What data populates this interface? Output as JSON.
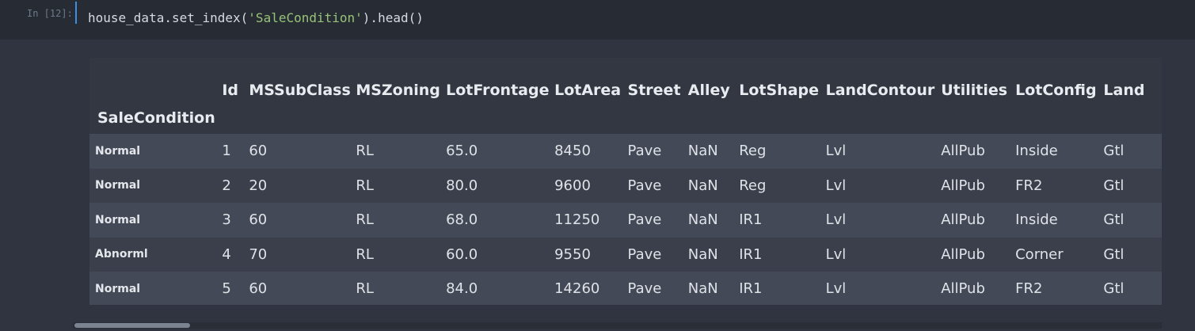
{
  "input": {
    "prompt": "In [12]:",
    "code_before": "house_data.set_index(",
    "code_string": "'SaleCondition'",
    "code_after": ").head()"
  },
  "table": {
    "index_name": "SaleCondition",
    "columns": [
      "Id",
      "MSSubClass",
      "MSZoning",
      "LotFrontage",
      "LotArea",
      "Street",
      "Alley",
      "LotShape",
      "LandContour",
      "Utilities",
      "LotConfig",
      "Land"
    ],
    "rows": [
      {
        "index": "Normal",
        "cells": [
          "1",
          "60",
          "RL",
          "65.0",
          "8450",
          "Pave",
          "NaN",
          "Reg",
          "Lvl",
          "AllPub",
          "Inside",
          "Gtl"
        ]
      },
      {
        "index": "Normal",
        "cells": [
          "2",
          "20",
          "RL",
          "80.0",
          "9600",
          "Pave",
          "NaN",
          "Reg",
          "Lvl",
          "AllPub",
          "FR2",
          "Gtl"
        ]
      },
      {
        "index": "Normal",
        "cells": [
          "3",
          "60",
          "RL",
          "68.0",
          "11250",
          "Pave",
          "NaN",
          "IR1",
          "Lvl",
          "AllPub",
          "Inside",
          "Gtl"
        ]
      },
      {
        "index": "Abnorml",
        "cells": [
          "4",
          "70",
          "RL",
          "60.0",
          "9550",
          "Pave",
          "NaN",
          "IR1",
          "Lvl",
          "AllPub",
          "Corner",
          "Gtl"
        ]
      },
      {
        "index": "Normal",
        "cells": [
          "5",
          "60",
          "RL",
          "84.0",
          "14260",
          "Pave",
          "NaN",
          "IR1",
          "Lvl",
          "AllPub",
          "FR2",
          "Gtl"
        ]
      }
    ]
  }
}
